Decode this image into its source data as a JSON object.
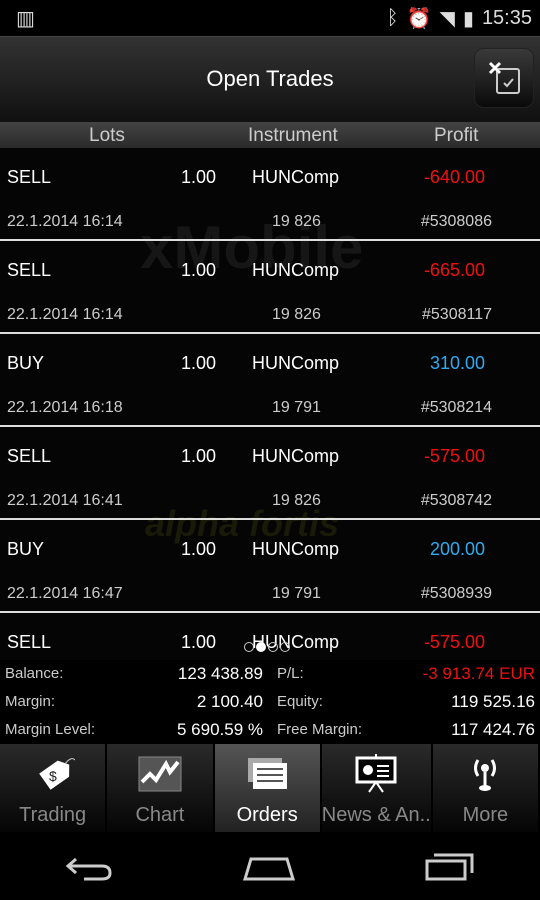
{
  "status": {
    "time": "15:35"
  },
  "title": "Open Trades",
  "columns": [
    "Lots",
    "Instrument",
    "Profit"
  ],
  "watermarks": [
    "xMobile",
    "alpha fortis"
  ],
  "colors": {
    "loss": "#ee1111",
    "gain": "#33aaee"
  },
  "trades": [
    {
      "type": "SELL",
      "lots": "1.00",
      "instrument": "HUNComp",
      "profit": "-640.00",
      "dir": "loss",
      "time": "22.1.2014 16:14",
      "price": "19 826",
      "id": "#5308086"
    },
    {
      "type": "SELL",
      "lots": "1.00",
      "instrument": "HUNComp",
      "profit": "-665.00",
      "dir": "loss",
      "time": "22.1.2014 16:14",
      "price": "19 826",
      "id": "#5308117"
    },
    {
      "type": "BUY",
      "lots": "1.00",
      "instrument": "HUNComp",
      "profit": "310.00",
      "dir": "gain",
      "time": "22.1.2014 16:18",
      "price": "19 791",
      "id": "#5308214"
    },
    {
      "type": "SELL",
      "lots": "1.00",
      "instrument": "HUNComp",
      "profit": "-575.00",
      "dir": "loss",
      "time": "22.1.2014 16:41",
      "price": "19 826",
      "id": "#5308742"
    },
    {
      "type": "BUY",
      "lots": "1.00",
      "instrument": "HUNComp",
      "profit": "200.00",
      "dir": "gain",
      "time": "22.1.2014 16:47",
      "price": "19 791",
      "id": "#5308939"
    },
    {
      "type": "SELL",
      "lots": "1.00",
      "instrument": "HUNComp",
      "profit": "-575.00",
      "dir": "loss",
      "time": "",
      "price": "",
      "id": ""
    }
  ],
  "pager": {
    "pages": 4,
    "current": 2
  },
  "summary": {
    "balance_label": "Balance:",
    "balance": "123 438.89",
    "pl_label": "P/L:",
    "pl": "-3 913.74 EUR",
    "margin_label": "Margin:",
    "margin": "2 100.40",
    "equity_label": "Equity:",
    "equity": "119 525.16",
    "margin_level_label": "Margin Level:",
    "margin_level": "5 690.59 %",
    "free_margin_label": "Free Margin:",
    "free_margin": "117 424.76"
  },
  "tabs": [
    {
      "label": "Trading",
      "icon": "price-tag-icon"
    },
    {
      "label": "Chart",
      "icon": "chart-icon"
    },
    {
      "label": "Orders",
      "icon": "orders-icon",
      "active": true
    },
    {
      "label": "News & An..",
      "icon": "presentation-icon"
    },
    {
      "label": "More",
      "icon": "antenna-icon"
    }
  ]
}
